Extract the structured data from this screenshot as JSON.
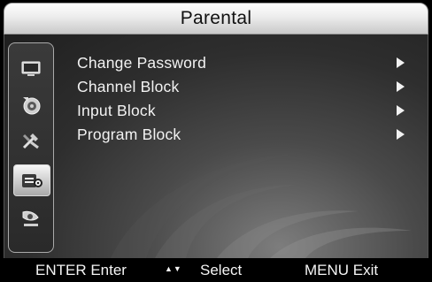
{
  "title": "Parental",
  "sidebar": {
    "icons": [
      {
        "name": "picture-icon"
      },
      {
        "name": "sound-icon"
      },
      {
        "name": "setup-icon"
      },
      {
        "name": "parental-lock-icon",
        "selected": true
      },
      {
        "name": "channel-icon"
      }
    ]
  },
  "menu": {
    "items": [
      {
        "label": "Change Password"
      },
      {
        "label": "Channel Block"
      },
      {
        "label": "Input Block"
      },
      {
        "label": "Program Block"
      }
    ]
  },
  "footer": {
    "enter": "ENTER Enter",
    "select_arrows": "▲▼",
    "select": "Select",
    "menu": "MENU Exit"
  },
  "colors": {
    "title_bar": "#e8e8e8",
    "background": "#3a3a3a",
    "text": "#f2f2f2",
    "selected_icon_bg": "#d8d8d8"
  }
}
